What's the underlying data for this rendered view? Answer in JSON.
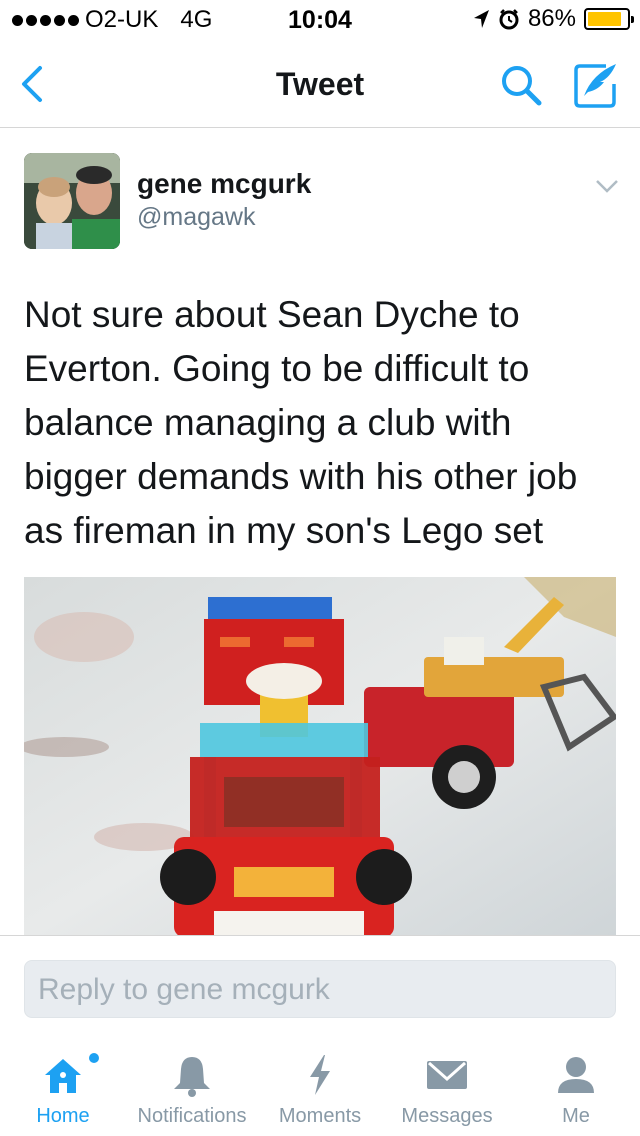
{
  "status_bar": {
    "carrier": "O2-UK",
    "network": "4G",
    "time": "10:04",
    "battery_percent": "86%",
    "battery_level": 0.86,
    "signal_bars": 5
  },
  "nav": {
    "title": "Tweet",
    "back_icon": "chevron-left-icon",
    "search_icon": "search-icon",
    "compose_icon": "compose-icon"
  },
  "tweet": {
    "author_name": "gene mcgurk",
    "author_handle": "@magawk",
    "text": "Not sure about Sean Dyche to Everton. Going to be difficult to balance managing a club with bigger demands with his other job as fireman in my son's Lego set"
  },
  "reply": {
    "placeholder": "Reply to gene mcgurk"
  },
  "tabs": [
    {
      "label": "Home",
      "icon": "home-icon",
      "active": true
    },
    {
      "label": "Notifications",
      "icon": "bell-icon",
      "active": false
    },
    {
      "label": "Moments",
      "icon": "lightning-icon",
      "active": false
    },
    {
      "label": "Messages",
      "icon": "envelope-icon",
      "active": false
    },
    {
      "label": "Me",
      "icon": "person-icon",
      "active": false
    }
  ],
  "colors": {
    "accent": "#1da1f2",
    "text": "#14171a",
    "secondary_text": "#657786",
    "tab_inactive": "#8899a6",
    "battery": "#ffc400"
  }
}
